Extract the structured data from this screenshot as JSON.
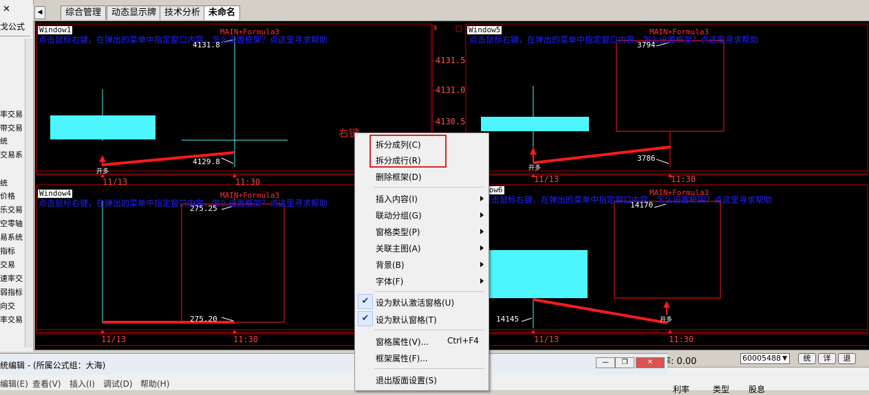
{
  "sidebar": {
    "close_glyph": "✕",
    "title": "戈公式",
    "items": [
      "率交易",
      "带交易",
      "统",
      "交易系",
      "统",
      "价格",
      "乐交易",
      "空零轴",
      "易系统",
      "指标",
      "交易",
      "速率交",
      "弱指标",
      "向交",
      "率交易"
    ]
  },
  "tabs": [
    "综合管理",
    "动态显示牌",
    "技术分析",
    "未命名"
  ],
  "active_tab": "未命名",
  "hint_text": "点击鼠标右键，在弹出的菜单中指定窗口内容，怎么设置框架？点这里寻求帮助",
  "formula": "MAIN+Formula3",
  "windows": {
    "w1": {
      "label": "Window1",
      "high": "4131.8",
      "low": "4129.8",
      "dates": [
        "11/13",
        "11:30"
      ],
      "trade": "开多"
    },
    "w5": {
      "label": "Window5",
      "high": "3794",
      "low": "3786",
      "dates": [
        "11/13",
        "11:30"
      ],
      "trade": "开多"
    },
    "w4": {
      "label": "Window4",
      "high": "275.25",
      "low": "275.20",
      "dates": [
        "11/13",
        "11:30"
      ]
    },
    "w6": {
      "label": "dow6",
      "high": "14170",
      "low": "14145",
      "dates": [
        "11/13",
        "11:30"
      ],
      "trade": "开多"
    }
  },
  "y_axis": [
    "4131.5",
    "4131.0",
    "4130.5"
  ],
  "right_click_label": "右键",
  "context_menu": {
    "items": [
      {
        "label": "拆分成列(C)"
      },
      {
        "label": "拆分成行(R)"
      },
      {
        "label": "删除框架(D)"
      },
      {
        "label": "插入内容(I)",
        "submenu": true
      },
      {
        "label": "联动分组(G)",
        "submenu": true
      },
      {
        "label": "窗格类型(P)",
        "submenu": true
      },
      {
        "label": "关联主图(A)",
        "submenu": true
      },
      {
        "label": "背景(B)",
        "submenu": true
      },
      {
        "label": "字体(F)",
        "submenu": true
      },
      {
        "label": "设为默认激活窗格(U)",
        "checked": true
      },
      {
        "label": "设为默认窗格(T)",
        "checked": true
      },
      {
        "label": "窗格属性(V)...",
        "shortcut": "Ctrl+F4"
      },
      {
        "label": "框架属性(F)..."
      },
      {
        "label": "退出版面设置(S)"
      }
    ]
  },
  "status": {
    "value": "率: 0.00",
    "combo": "60005488",
    "buttons": [
      "统",
      "详",
      "退"
    ]
  },
  "editor": {
    "title": "统编辑 - (所属公式组：大海)",
    "menus": [
      "编辑(E)",
      "查看(V)",
      "插入(I)",
      "调试(D)",
      "帮助(H)"
    ],
    "winbtns": [
      "—",
      "❐",
      "✕"
    ]
  },
  "bottom_headers": [
    "利率",
    "类型",
    "股息"
  ],
  "colors": {
    "candle": "#4cf6fc",
    "frame": "#c00000",
    "trend": "#ff1a1a",
    "hint": "#2020ff"
  }
}
